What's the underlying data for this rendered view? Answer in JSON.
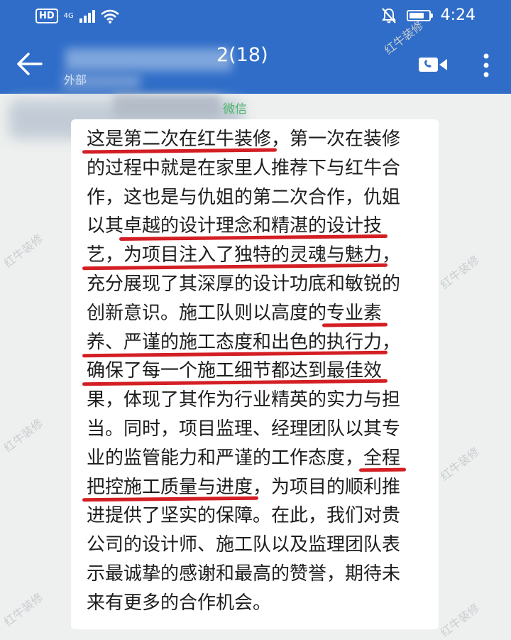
{
  "status_bar": {
    "hd": "HD",
    "network": "4G",
    "time": "4:24",
    "battery_level": 0.8,
    "icons": [
      "hd-icon",
      "signal-icon",
      "wifi-icon",
      "mute-bell-icon",
      "battery-icon"
    ]
  },
  "header": {
    "title_count": "2(18)",
    "subtitle": "外部",
    "icons": [
      "back-arrow-icon",
      "video-call-icon",
      "more-vertical-icon"
    ]
  },
  "chat": {
    "sender_tag": "微信",
    "watermark": "红牛装修",
    "message": {
      "lines": [
        [
          {
            "text": "这是第二次在红牛装修",
            "u": true
          },
          {
            "text": "，第一次在装修",
            "u": false
          }
        ],
        [
          {
            "text": "的过程中就是在家里人推荐下与红牛合",
            "u": false
          }
        ],
        [
          {
            "text": "作，这也是与仇姐的第二次合作，仇姐",
            "u": false
          }
        ],
        [
          {
            "text": "以其",
            "u": false
          },
          {
            "text": "卓越的设计理念和精湛的设计技",
            "u": true
          }
        ],
        [
          {
            "text": "艺，为项目注入了独特的灵魂与魅力",
            "u": true
          },
          {
            "text": "，",
            "u": false
          }
        ],
        [
          {
            "text": "充分展现了其深厚的设计功底和敏锐的",
            "u": false
          }
        ],
        [
          {
            "text": "创新意识。施工队则以高度的",
            "u": false
          },
          {
            "text": "专业素",
            "u": true
          }
        ],
        [
          {
            "text": "养、严谨的施工态度和出色的执行力",
            "u": true
          },
          {
            "text": "，",
            "u": false
          }
        ],
        [
          {
            "text": "确保了每一个施工细节都达到最佳效",
            "u": true
          }
        ],
        [
          {
            "text": "果，体现了其作为行业精英的实力与担",
            "u": false
          }
        ],
        [
          {
            "text": "当。同时，项目监理、经理团队以其专",
            "u": false
          }
        ],
        [
          {
            "text": "业的监管能力和严谨的工作态度，",
            "u": false
          },
          {
            "text": "全程",
            "u": true
          }
        ],
        [
          {
            "text": "把控施工质量与进度",
            "u": true
          },
          {
            "text": "，为项目的顺利推",
            "u": false
          }
        ],
        [
          {
            "text": "进提供了坚实的保障。在此，我们对贵",
            "u": false
          }
        ],
        [
          {
            "text": "公司的设计师、施工队以及监理团队表",
            "u": false
          }
        ],
        [
          {
            "text": "示最诚挚的感谢和最高的赞誉，期待未",
            "u": false
          }
        ],
        [
          {
            "text": "来有更多的合作机会。",
            "u": false
          }
        ]
      ]
    }
  }
}
